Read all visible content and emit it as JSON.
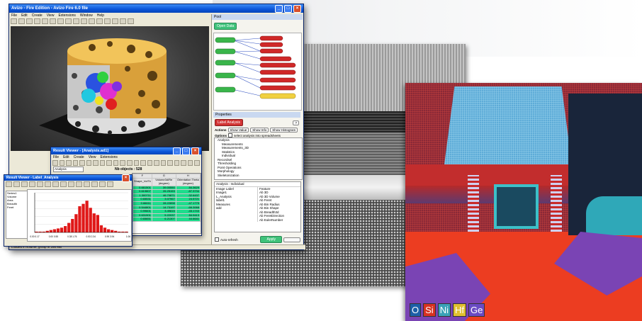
{
  "main_window": {
    "title": "Avizo - Fire Edition - Avizo Fire 6.0 file",
    "menu": [
      "File",
      "Edit",
      "Create",
      "View",
      "Extensions",
      "Window",
      "Help"
    ],
    "pool_label": "Pool",
    "pool_button": "Open Data",
    "properties_label": "Properties",
    "analysis_label": "Analysis / Individual",
    "analysis_header_btn": "Label Analysis",
    "actions_label": "Actions",
    "actions_buttons": [
      "Show Value",
      "Show Info",
      "Show Histogram"
    ],
    "options_label": "Options",
    "options_checkbox": "select analysis into spreadsheets",
    "measures_label": "Measures",
    "tree_items": [
      "Analysis",
      "Measurements",
      "Measurements_3D",
      "Statistics",
      "Individual",
      "Recordsel",
      "Thresholding",
      "Point Operations",
      "Morphology",
      "Skeletonization"
    ],
    "analysis_title": "Analysis : Individual",
    "analysis_list_left": [
      "Image Label",
      "Image1",
      "L_Analysis",
      "label1",
      "Measures",
      "add"
    ],
    "analysis_list_right": [
      "Feature",
      "Ab 3D",
      "Ab 3D Volume",
      "Ab Feret",
      "Ab Bin Radius",
      "Ab Bin Shape",
      "Ab Breadth3d",
      "Ab FeretDirection",
      "Ab EulerNumber"
    ],
    "auto_refresh": "Auto-refresh",
    "apply_button": "Apply",
    "status": "Loaded in volume, group in 256 MB"
  },
  "result_viewer": {
    "title": "Result Viewer - [Analysis.ad1]",
    "toolbar_field": "Analysis",
    "object_count": "Nb objects : 528",
    "columns": [
      "Shape_VolTk",
      "Volume3d/Re (degree)",
      "Orientation Theta (degree)"
    ],
    "col_letters": [
      "F",
      "G",
      "H"
    ],
    "rows": [
      [
        "0.661501",
        "39.00550",
        "84.3629"
      ],
      [
        "0.619807",
        "26.25153",
        "-87.3734"
      ],
      [
        "1.300711",
        "46.70871",
        "-32.6437"
      ],
      [
        "0.65531",
        "3.07967",
        "24.5721"
      ],
      [
        "0.66611",
        "28.22898",
        "-47.1775"
      ],
      [
        "0.544801",
        "14.73197",
        "-66.3068"
      ],
      [
        "0.99601",
        "3.49815",
        "-45.1743"
      ],
      [
        "0.631901",
        "5.22037",
        "84.9413"
      ],
      [
        "0.65651",
        "6.21307",
        "44.6641"
      ]
    ]
  },
  "histogram_window": {
    "title": "Result Viewer - Label_Analysis",
    "legend_items": [
      "Series1",
      "Volume",
      "Area",
      "Breadth",
      "Feret"
    ],
    "x_ticks": [
      "0.00 0.17",
      "0.00 0.55",
      "0.38 1.76",
      "0.53 2.34",
      "0.90 3.94",
      "1.06"
    ]
  },
  "chart_data": {
    "type": "bar",
    "values": [
      1,
      1,
      1,
      2,
      3,
      4,
      5,
      6,
      8,
      12,
      17,
      23,
      33,
      36,
      40,
      31,
      24,
      22,
      9,
      6,
      4,
      3,
      2,
      1,
      1,
      1
    ],
    "ylim": [
      0,
      50
    ],
    "colors": {
      "bars": "#e01818",
      "axes": "#000000"
    }
  },
  "eds_legend": [
    {
      "label": "O",
      "color": "#1d5fa8"
    },
    {
      "label": "Si",
      "color": "#d83222"
    },
    {
      "label": "Ni",
      "color": "#3aa2b8"
    },
    {
      "label": "Hf",
      "color": "#e0c030"
    },
    {
      "label": "Ge",
      "color": "#6a4bc4"
    }
  ]
}
